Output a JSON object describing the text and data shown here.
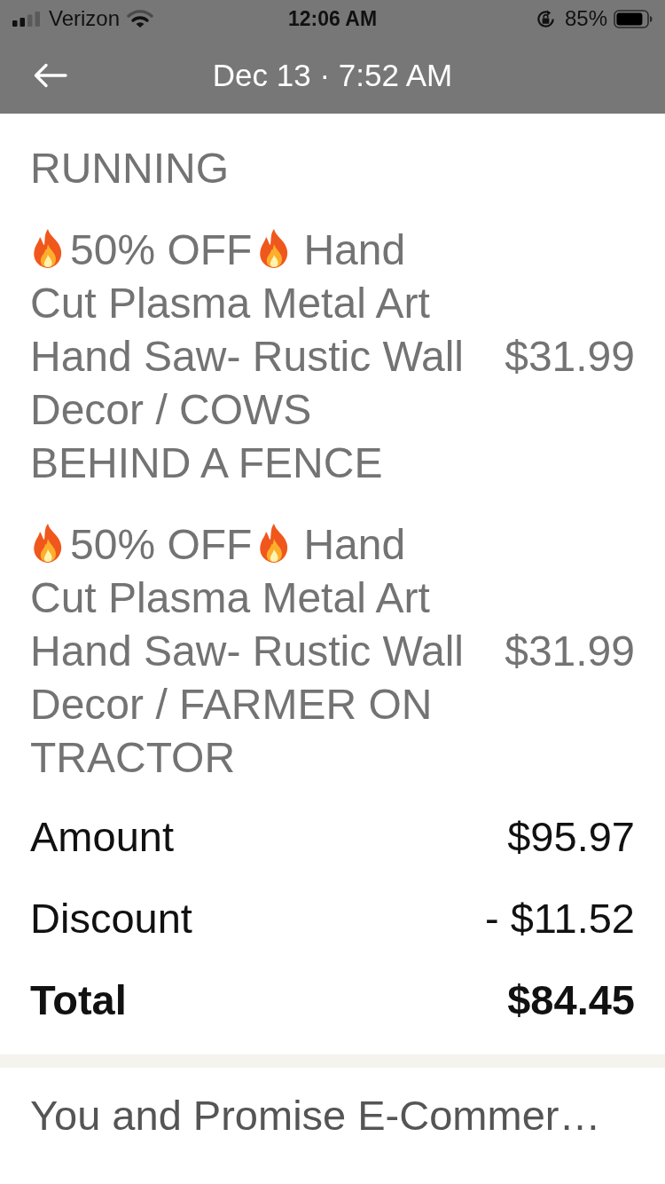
{
  "status_bar": {
    "carrier": "Verizon",
    "time": "12:06 AM",
    "battery": "85%"
  },
  "header": {
    "title": "Dec 13 · 7:52 AM"
  },
  "items": [
    {
      "name": "RUNNING"
    },
    {
      "badge": "50% OFF",
      "name": "Hand Cut Plasma Metal Art Hand Saw- Rustic Wall Decor / COWS BEHIND A FENCE",
      "price": "$31.99"
    },
    {
      "badge": "50% OFF",
      "name": "Hand Cut Plasma Metal Art Hand Saw- Rustic Wall Decor / FARMER ON TRACTOR",
      "price": "$31.99"
    }
  ],
  "summary": [
    {
      "kind": "line",
      "label": "Amount",
      "value": "$95.97"
    },
    {
      "kind": "line",
      "label": "Discount",
      "value": "- $11.52"
    },
    {
      "kind": "total",
      "label": "Total",
      "value": "$84.45"
    }
  ],
  "footer": {
    "text": "You and Promise E-Commer…"
  }
}
